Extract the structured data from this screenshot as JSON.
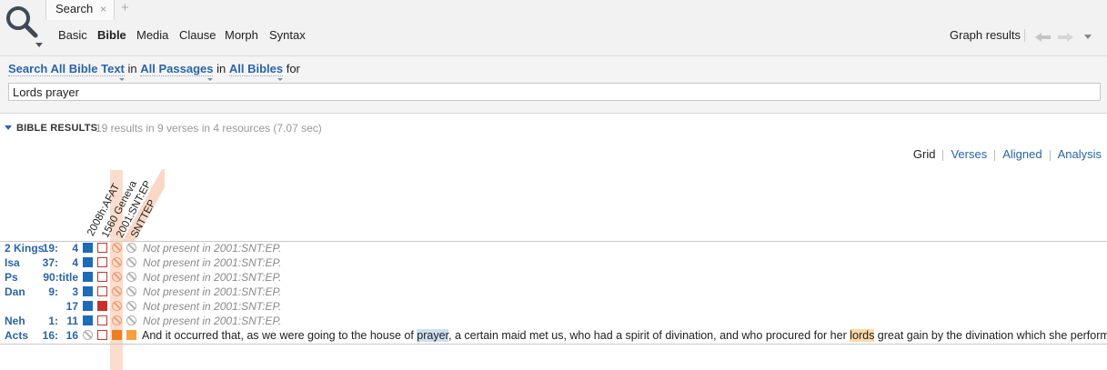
{
  "toolbar": {
    "tab_label": "Search",
    "tab_close": "×",
    "tab_add": "+",
    "subnav": [
      "Basic",
      "Bible",
      "Media",
      "Clause",
      "Morph",
      "Syntax"
    ],
    "active_subnav": "Bible",
    "graph_results": "Graph results"
  },
  "query": {
    "search_link": "Search All Bible Text",
    "in1": "in",
    "passages_link": "All Passages",
    "in2": "in",
    "bibles_link": "All Bibles",
    "for": "for",
    "value": "Lords prayer"
  },
  "results": {
    "title": "BIBLE RESULTS",
    "summary": "19 results in 9 verses in 4 resources (7.07 sec)"
  },
  "views": [
    "Grid",
    "Verses",
    "Aligned",
    "Analysis"
  ],
  "active_view": "Grid",
  "columns": [
    "2008h:AFAT",
    "1560 Geneva",
    "2001:SNT:EP",
    "SNTTEP"
  ],
  "rows": [
    {
      "book": "2 Kings",
      "chapter": "19:",
      "verse": "4",
      "note": "Not present in 2001:SNT:EP."
    },
    {
      "book": "Isa",
      "chapter": "37:",
      "verse": "4",
      "note": "Not present in 2001:SNT:EP."
    },
    {
      "book": "Ps",
      "chapter": "90:title",
      "verse": "",
      "note": "Not present in 2001:SNT:EP."
    },
    {
      "book": "Dan",
      "chapter": "9:",
      "verse": "3",
      "note": "Not present in 2001:SNT:EP."
    },
    {
      "book": "",
      "chapter": "",
      "verse": "17",
      "note": "Not present in 2001:SNT:EP."
    },
    {
      "book": "Neh",
      "chapter": "1:",
      "verse": "11",
      "note": "Not present in 2001:SNT:EP."
    },
    {
      "book": "Acts",
      "chapter": "16:",
      "verse": "16",
      "note": ""
    }
  ],
  "acts_text": {
    "part1": "And it occurred that, as we were going to the house of ",
    "hit1": "prayer",
    "part2": ", a certain maid met us, who had a spirit of divination, and who procured for her ",
    "hit2": "lords",
    "part3": " great gain by the divination which she performed."
  },
  "colors": {
    "link": "#2a64a8",
    "hit_blue": "#1e6bb8",
    "hit_red": "#c9302c",
    "hit_orange": "#f07e1f",
    "band": "#f9d9c6"
  }
}
